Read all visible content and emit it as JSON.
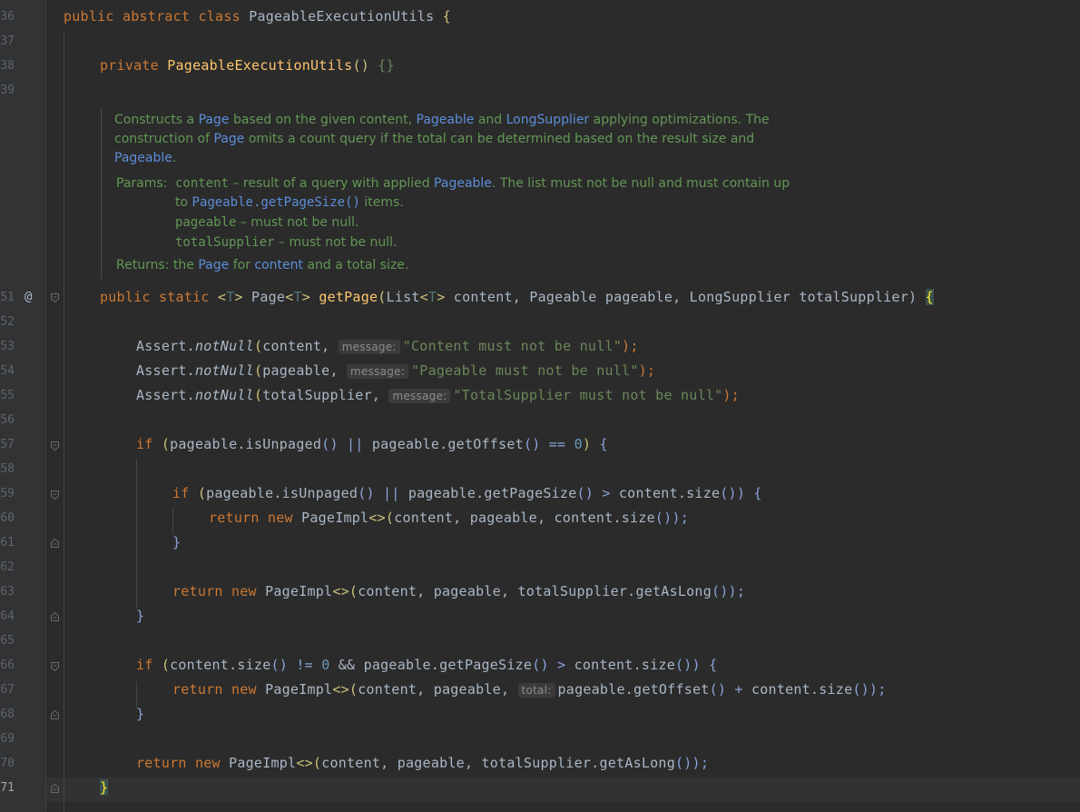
{
  "editor": {
    "line_numbers": [
      "36",
      "37",
      "38",
      "39",
      "51",
      "52",
      "53",
      "54",
      "55",
      "56",
      "57",
      "58",
      "59",
      "60",
      "61",
      "62",
      "63",
      "64",
      "65",
      "66",
      "67",
      "68",
      "69",
      "70",
      "71"
    ],
    "override_marker": "@",
    "class_decl": {
      "kw1": "public",
      "kw2": "abstract",
      "kw3": "class",
      "name": "PageableExecutionUtils",
      "brace": "{"
    },
    "ctor": {
      "kw": "private",
      "name": "PageableExecutionUtils",
      "sig": "() ",
      "body": "{}"
    },
    "javadoc": {
      "l1a": "Constructs a ",
      "l1b": "Page",
      "l1c": " based on the given ",
      "l1d": "content",
      ", ": "",
      "l1e": ", ",
      "l1f": "Pageable",
      "l1g": " and ",
      "l1h": "LongSupplier",
      "l1i": " applying optimizations. The",
      "l2a": "construction of ",
      "l2b": "Page",
      "l2c": " omits a count query if the total can be determined based on the result size and",
      "l3a": "Pageable",
      ".": "",
      "l3b": ".",
      "params_label": "Params:",
      "p1a": "content",
      "p1b": " – result of a query with applied ",
      "p1c": "Pageable",
      "p1d": ". The list must not be null and must contain up",
      "p2a": "to ",
      "p2b": "Pageable.getPageSize()",
      "p2c": " items.",
      "p3a": "pageable",
      "p3b": " – must not be null.",
      "p4a": "totalSupplier",
      "p4b": " – must not be null.",
      "returns_label": "Returns:",
      "r1": " the ",
      "r2": "Page",
      "r3": " for ",
      "r4": "content",
      "r5": " and a total size."
    },
    "method": {
      "kw1": "public",
      "kw2": "static",
      "tp_open": "<",
      "T": "T",
      "tp_close": ">",
      "ret": " Page",
      "ret_gen": "<",
      "ret_T": "T",
      "ret_gen_close": ">",
      "name": "getPage",
      "open": "(",
      "p_type1": "List",
      "p_gen": "<",
      "p_T": "T",
      "p_gen_close": ">",
      "rest": " content, Pageable pageable, LongSupplier totalSupplier)",
      "brace": "{"
    },
    "assert1": {
      "a": "Assert.",
      "m": "notNull",
      "o": "(",
      "v": "content, ",
      "hint": "message:",
      "s": "\"Content must not be null\"",
      "e": ");"
    },
    "assert2": {
      "a": "Assert.",
      "m": "notNull",
      "o": "(",
      "v": "pageable, ",
      "hint": "message:",
      "s": "\"Pageable must not be null\"",
      "e": ");"
    },
    "assert3": {
      "a": "Assert.",
      "m": "notNull",
      "o": "(",
      "v": "totalSupplier, ",
      "hint": "message:",
      "s": "\"TotalSupplier must not be null\"",
      "e": ");"
    },
    "if1": {
      "kw": "if",
      "p": " (",
      "c1": "pageable.isUnpaged",
      "c2": "() || ",
      "c3": "pageable.getOffset",
      "c4": "() == ",
      "n": "0",
      "c5": ") ",
      "b": "{"
    },
    "if2": {
      "kw": "if",
      "p": " (",
      "c1": "pageable.isUnpaged",
      "c2": "() || ",
      "c3": "pageable.getPageSize",
      "c4": "() > ",
      "c5": "content.size",
      "c6": "()) ",
      "b": "{"
    },
    "ret1": {
      "kw1": "return",
      "kw2": "new",
      "c": " PageImpl",
      "g": "<>",
      "o": "(",
      "r": "content, pageable, content.size",
      "e": "());"
    },
    "close_b1": "}",
    "ret2": {
      "kw1": "return",
      "kw2": "new",
      "c": " PageImpl",
      "g": "<>",
      "o": "(",
      "r": "content, pageable, totalSupplier.getAsLong",
      "e": "());"
    },
    "close_b2": "}",
    "if3": {
      "kw": "if",
      "p": " (",
      "c1": "content.size",
      "c2": "() != ",
      "n": "0",
      "c3": " && pageable.getPageSize",
      "c4": "() > ",
      "c5": "content.size",
      "c6": "()) ",
      "b": "{"
    },
    "ret3": {
      "kw1": "return",
      "kw2": "new",
      "c": " PageImpl",
      "g": "<>",
      "o": "(",
      "r": "content, pageable, ",
      "hint": "total:",
      "r2": "pageable.getOffset",
      "r3": "() + ",
      "r4": "content.size",
      "e": "());"
    },
    "close_b3": "}",
    "ret4": {
      "kw1": "return",
      "kw2": "new",
      "c": " PageImpl",
      "g": "<>",
      "o": "(",
      "r": "content, pageable, totalSupplier.getAsLong",
      "e": "());"
    },
    "close_method": "}"
  },
  "colors": {
    "background": "#2b2b2b",
    "keyword": "#cc7832",
    "method_decl": "#ffc66d",
    "string": "#6a8759",
    "number": "#6897bb",
    "javadoc": "#629755",
    "doc_link": "#5c8ed9"
  }
}
